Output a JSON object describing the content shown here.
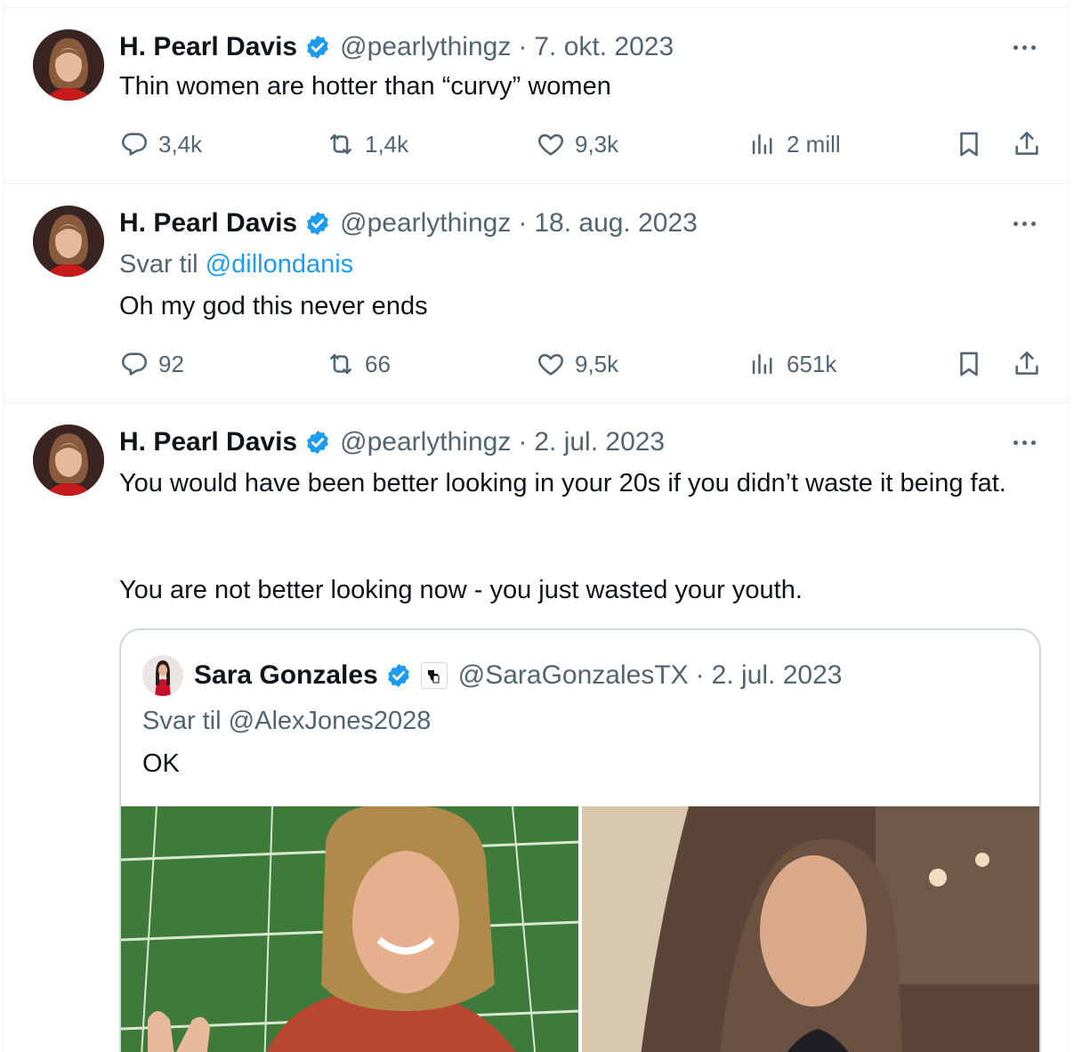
{
  "author": {
    "display_name": "H. Pearl Davis",
    "handle": "@pearlythingz"
  },
  "separator": "·",
  "tweets": [
    {
      "date": "7. okt. 2023",
      "text": "Thin women are hotter than “curvy” women",
      "replies": "3,4k",
      "retweets": "1,4k",
      "likes": "9,3k",
      "views": "2 mill"
    },
    {
      "date": "18. aug. 2023",
      "reply_prefix": "Svar til",
      "reply_to": "@dillondanis",
      "text": "Oh my god this never ends",
      "replies": "92",
      "retweets": "66",
      "likes": "9,5k",
      "views": "651k"
    },
    {
      "date": "2. jul. 2023",
      "text_line1": "You would have been better looking in your 20s if you didn’t waste it being fat.",
      "text_line2": "You are not better looking now - you just wasted your youth.",
      "quoted": {
        "display_name": "Sara Gonzales",
        "handle": "@SaraGonzalesTX",
        "date": "2. jul. 2023",
        "reply_text": "Svar til @AlexJones2028",
        "text": "OK"
      }
    }
  ],
  "icons": {
    "verified": "verified-badge-icon",
    "more": "more-options-icon",
    "reply": "reply-icon",
    "retweet": "retweet-icon",
    "like": "heart-icon",
    "views": "views-chart-icon",
    "bookmark": "bookmark-icon",
    "share": "share-icon"
  },
  "colors": {
    "text": "#0f1419",
    "secondary": "#536471",
    "accent": "#1d9bf0",
    "border": "#eff3f4"
  }
}
